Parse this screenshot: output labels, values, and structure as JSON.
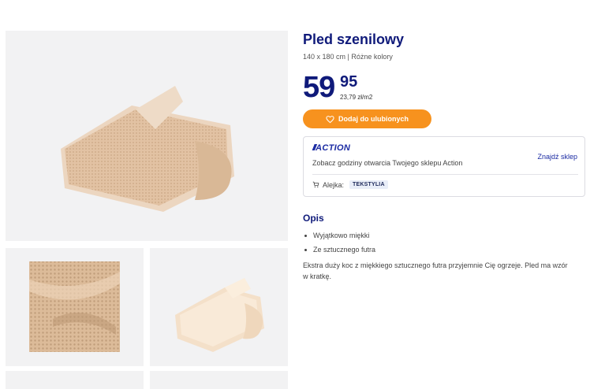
{
  "product": {
    "title": "Pled szenilowy",
    "subtitle": "140 x 180 cm | Różne kolory",
    "price_main": "59",
    "price_cents": "95",
    "price_unit": "23,79 zł/m2",
    "favorite_label": "Dodaj do ulubionych"
  },
  "store": {
    "logo_text": "ACTION",
    "hours_text": "Zobacz godziny otwarcia Twojego sklepu Action",
    "find_store_label": "Znajdź sklep",
    "aisle_label": "Alejka:",
    "aisle_value": "TEKSTYLIA"
  },
  "description": {
    "heading": "Opis",
    "bullets": [
      "Wyjątkowo miękki",
      "Ze sztucznego futra"
    ],
    "text": "Ekstra duży koc z miękkiego sztucznego futra przyjemnie Cię ogrzeje. Pled ma wzór w kratkę."
  },
  "colors": {
    "brand_blue": "#0f1a7a",
    "accent_orange": "#f7921e",
    "blanket_beige": "#e3c5a8"
  },
  "icons": {
    "favorite": "heart-icon",
    "aisle": "cart-icon"
  }
}
